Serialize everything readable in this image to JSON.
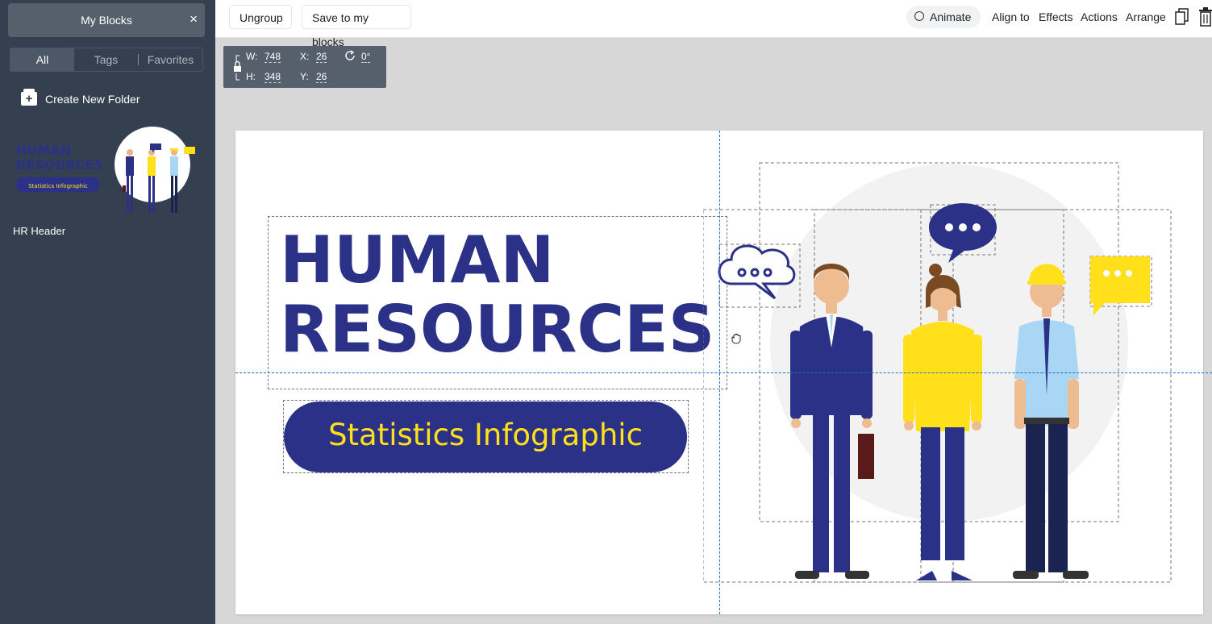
{
  "sidebar": {
    "title": "My Blocks",
    "close_icon": "×",
    "tabs": [
      "All",
      "Tags",
      "Favorites"
    ],
    "active_tab": "All",
    "create_folder_label": "Create New Folder",
    "block": {
      "name": "HR Header",
      "thumb_title_1": "HUMAN",
      "thumb_title_2": "RESOURCES",
      "thumb_subtitle": "Statistics Infographic"
    }
  },
  "toolbar": {
    "ungroup_label": "Ungroup",
    "save_label": "Save to my blocks",
    "animate_label": "Animate",
    "align_label": "Align to",
    "effects_label": "Effects",
    "actions_label": "Actions",
    "arrange_label": "Arrange",
    "copy_icon": "copy-icon",
    "delete_icon": "trash-icon"
  },
  "dimensions": {
    "w_label": "W:",
    "w_value": "748",
    "h_label": "H:",
    "h_value": "348",
    "x_label": "X:",
    "x_value": "26",
    "y_label": "Y:",
    "y_value": "26",
    "rotation": "0°"
  },
  "canvas": {
    "title_line1": "HUMAN",
    "title_line2": "RESOURCES",
    "subtitle": "Statistics Infographic",
    "colors": {
      "navy": "#2b3186",
      "yellow": "#ffe01b",
      "light_blue": "#a9d6f5",
      "circle_bg": "#f2f2f2",
      "guide": "#1e6bc8"
    }
  }
}
